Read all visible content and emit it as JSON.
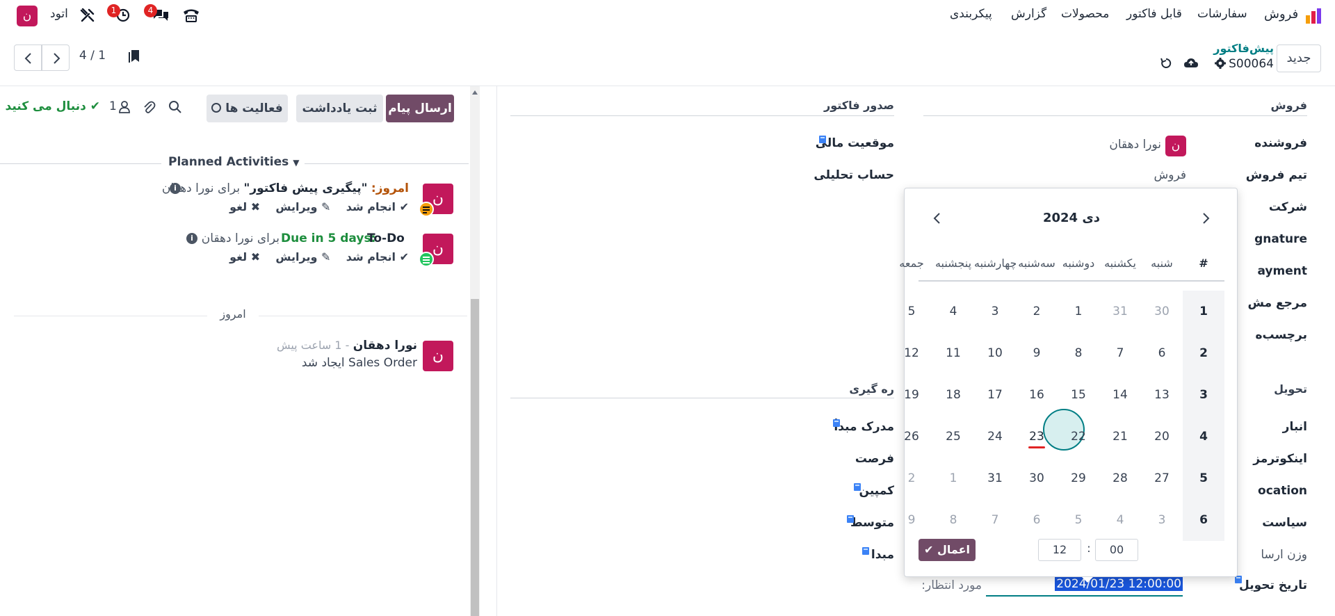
{
  "nav": {
    "app_name": "فروش",
    "menu": [
      "سفارشات",
      "قابل فاکتور",
      "محصولات",
      "گزارش",
      "پیکربندی"
    ],
    "user_name": "اتود",
    "user_initial": "ن",
    "badge_messages": "4",
    "badge_activities": "1"
  },
  "ctrl": {
    "new_label": "جدید",
    "breadcrumb_parent": "پیش‌فاکتور",
    "record_name": "S00064",
    "pager": "4 / 1"
  },
  "chatter": {
    "send_message": "ارسال پیام",
    "log_note": "ثبت یادداشت",
    "activities": "فعالیت ها",
    "follow": "دنبال می کنید",
    "followers_count": "1",
    "planned_title": "Planned Activities",
    "activity1": {
      "due": "امروز:",
      "title": "\"پیگیری پیش فاکتور\"",
      "for_text": "برای نورا دهقان",
      "done": "انجام شد",
      "edit": "ویرایش",
      "cancel": "لغو"
    },
    "activity2": {
      "due": "Due in 5 days:",
      "title": "To-Do",
      "for_text": "برای نورا دهقان",
      "done": "انجام شد",
      "edit": "ویرایش",
      "cancel": "لغو"
    },
    "today_sep": "امروز",
    "message": {
      "author": "نورا دهقان",
      "time": "- 1 ساعت پیش",
      "body": "Sales Order ایجاد شد"
    }
  },
  "form": {
    "sales_title": "فروش",
    "invoicing_title": "صدور فاکتور",
    "salesperson_label": "فروشنده",
    "salesperson_value": "نورا دهقان",
    "sales_team_label": "تیم فروش",
    "sales_team_value": "فروش",
    "company_label": "شرکت",
    "signature_label": "gnature",
    "payment_label": "ayment",
    "customer_ref_label": "مرجع مش",
    "tags_label": "برچسب‌ه",
    "fiscal_position_label": "موقعیت مالی",
    "analytic_label": "حساب تحلیلی",
    "delivery_title": "تحویل",
    "tracking_title": "ره گیری",
    "warehouse_label": "انبار",
    "incoterm_label": "اینکوترمز",
    "location_label": "ocation",
    "policy_label": "سیاست",
    "shipping_weight_label": "وزن ارسا",
    "delivery_date_label": "تاریخ تحویل",
    "delivery_date_value": "2024/01/23 12:00:00",
    "expected_label": "مورد انتظار:",
    "source_document_label": "مدرک مبدأ",
    "opportunity_label": "فرصت",
    "campaign_label": "کمپین",
    "medium_label": "متوسط",
    "source_label": "مبدا"
  },
  "datepicker": {
    "title": "دی 2024",
    "week_header": "#",
    "days": [
      "شنبه",
      "یکشنبه",
      "دوشنبه",
      "سه‌شنبه",
      "چهارشنبه",
      "پنجشنبه",
      "جمعه"
    ],
    "weeks": [
      "1",
      "2",
      "3",
      "4",
      "5",
      "6"
    ],
    "rows": [
      [
        "30",
        "31",
        "1",
        "2",
        "3",
        "4",
        "5"
      ],
      [
        "6",
        "7",
        "8",
        "9",
        "10",
        "11",
        "12"
      ],
      [
        "13",
        "14",
        "15",
        "16",
        "17",
        "18",
        "19"
      ],
      [
        "20",
        "21",
        "22",
        "23",
        "24",
        "25",
        "26"
      ],
      [
        "27",
        "28",
        "29",
        "30",
        "31",
        "1",
        "2"
      ],
      [
        "3",
        "4",
        "5",
        "6",
        "7",
        "8",
        "9"
      ]
    ],
    "muted": [
      [
        true,
        true,
        false,
        false,
        false,
        false,
        false
      ],
      [
        false,
        false,
        false,
        false,
        false,
        false,
        false
      ],
      [
        false,
        false,
        false,
        false,
        false,
        false,
        false
      ],
      [
        false,
        false,
        false,
        false,
        false,
        false,
        false
      ],
      [
        false,
        false,
        false,
        false,
        false,
        true,
        true
      ],
      [
        true,
        true,
        true,
        true,
        true,
        true,
        true
      ]
    ],
    "selected": "23",
    "hour": "12",
    "minute": "00",
    "time_sep": ":",
    "apply": "اعمال"
  },
  "colors": {
    "accent": "#714b67",
    "avatar": "#c2185b",
    "teal": "#017e84",
    "green": "#1e8e3e"
  }
}
